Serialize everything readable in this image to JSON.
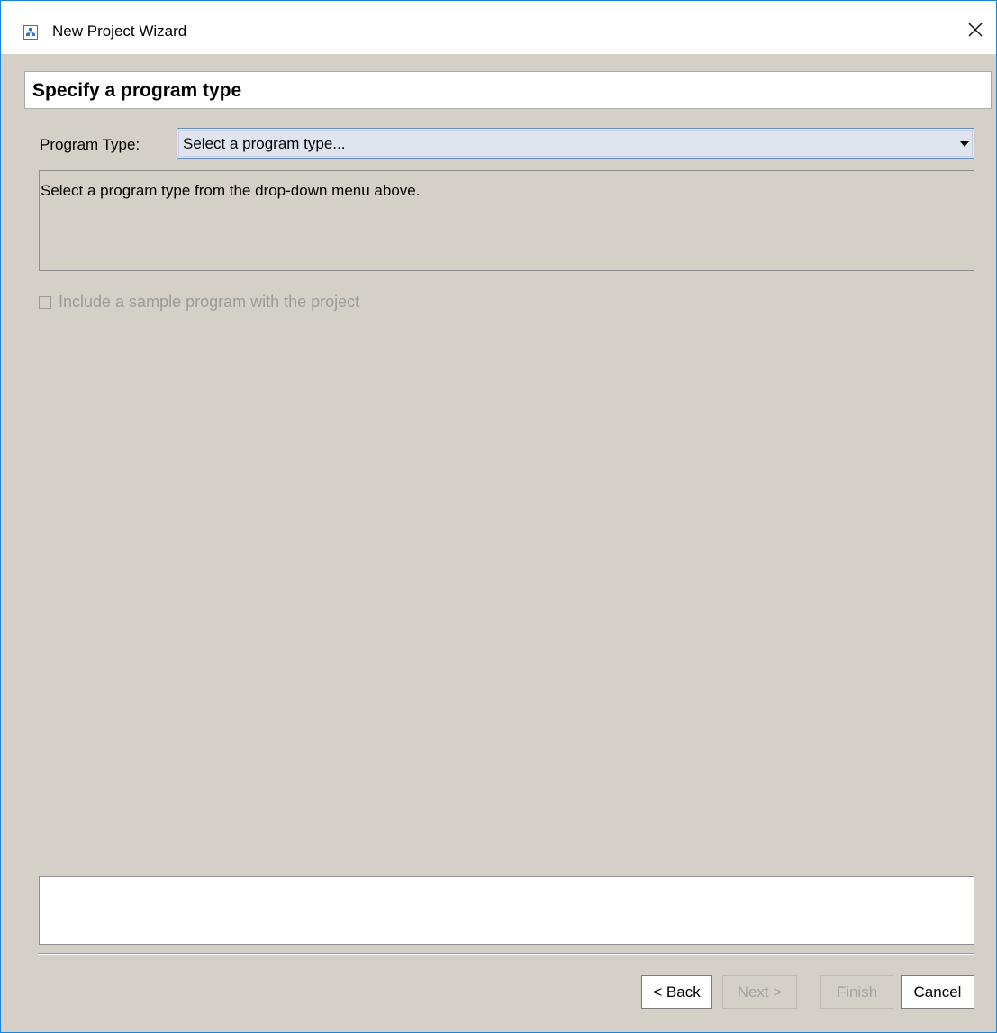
{
  "window": {
    "title": "New Project Wizard",
    "icon": "wizard-app-icon",
    "close_icon": "close-icon"
  },
  "header": {
    "title": "Specify a program type"
  },
  "program_type": {
    "label": "Program Type:",
    "selected_value": "Select a program type..."
  },
  "description": {
    "text": "Select a program type from the drop-down menu above."
  },
  "sample_option": {
    "label": "Include a sample program with the project",
    "checked": false,
    "enabled": false
  },
  "buttons": {
    "back": "< Back",
    "next": "Next >",
    "finish": "Finish",
    "cancel": "Cancel"
  },
  "colors": {
    "window_border": "#1883d7",
    "dialog_background": "#d4d0c8",
    "combo_background": "#dfe4ee"
  }
}
